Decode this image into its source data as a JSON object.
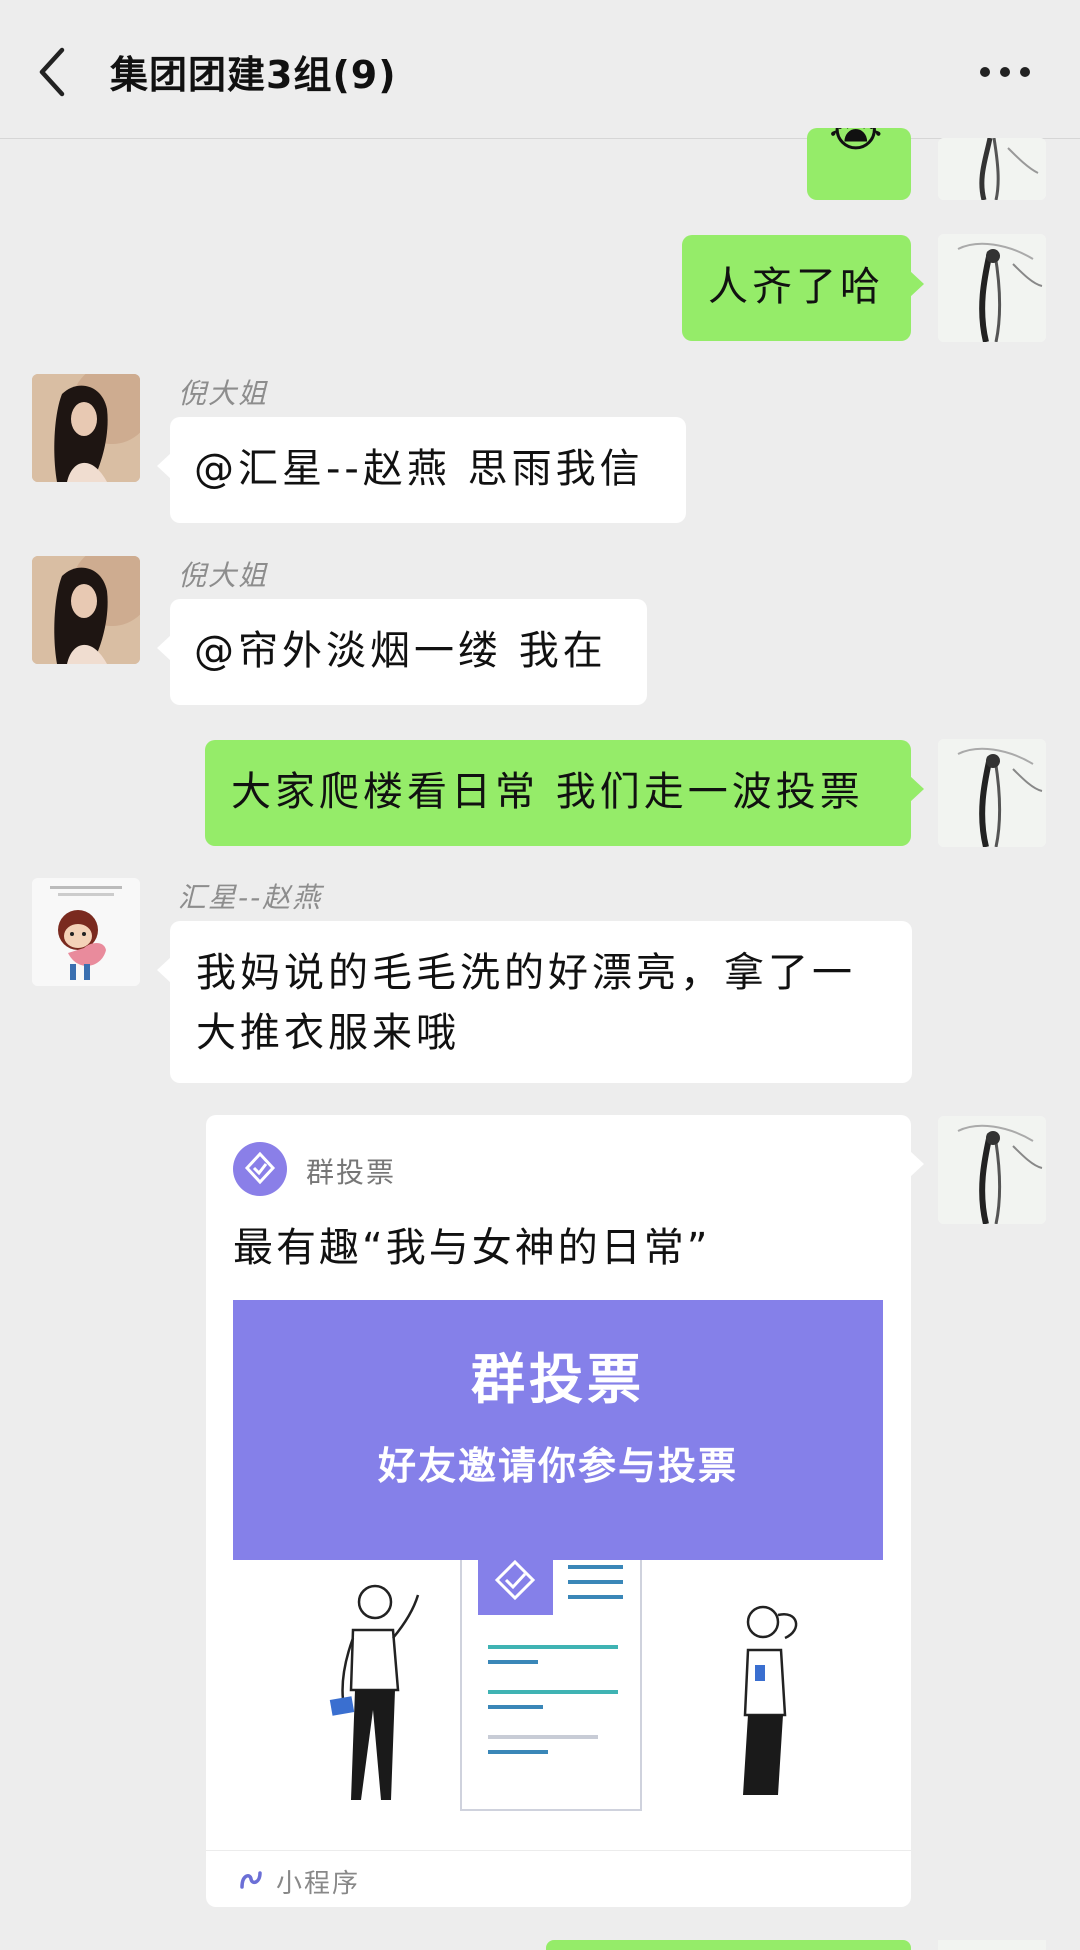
{
  "header": {
    "title": "集团团建3组(9)"
  },
  "messages": [
    {
      "id": "m1",
      "side": "right",
      "content": "😭",
      "partial": true
    },
    {
      "id": "m2",
      "side": "right",
      "content": "人齐了哈"
    },
    {
      "id": "m3",
      "side": "left",
      "sender": "倪大姐",
      "content": "@汇星--赵燕  思雨我信"
    },
    {
      "id": "m4",
      "side": "left",
      "sender": "倪大姐",
      "content": "@帘外淡烟一缕  我在"
    },
    {
      "id": "m5",
      "side": "right",
      "content": "大家爬楼看日常 我们走一波投票"
    },
    {
      "id": "m6",
      "side": "left",
      "sender": "汇星--赵燕",
      "content_line1": "我妈说的毛毛洗的好漂亮，拿了一",
      "content_line2": "大推衣服来哦"
    }
  ],
  "vote_card": {
    "source": "群投票",
    "title": "最有趣“我与女神的日常”",
    "banner_title": "群投票",
    "banner_subtitle": "好友邀请你参与投票",
    "footer_label": "小程序"
  },
  "colors": {
    "background": "#ededed",
    "self_bubble": "#95ec69",
    "other_bubble": "#ffffff",
    "banner": "#8580e9",
    "accent_teal": "#3fb3b3"
  },
  "icons": {
    "back": "chevron-left-icon",
    "more": "more-dots-icon",
    "vote_logo": "check-diamond-icon",
    "mini_program": "mini-program-icon"
  }
}
